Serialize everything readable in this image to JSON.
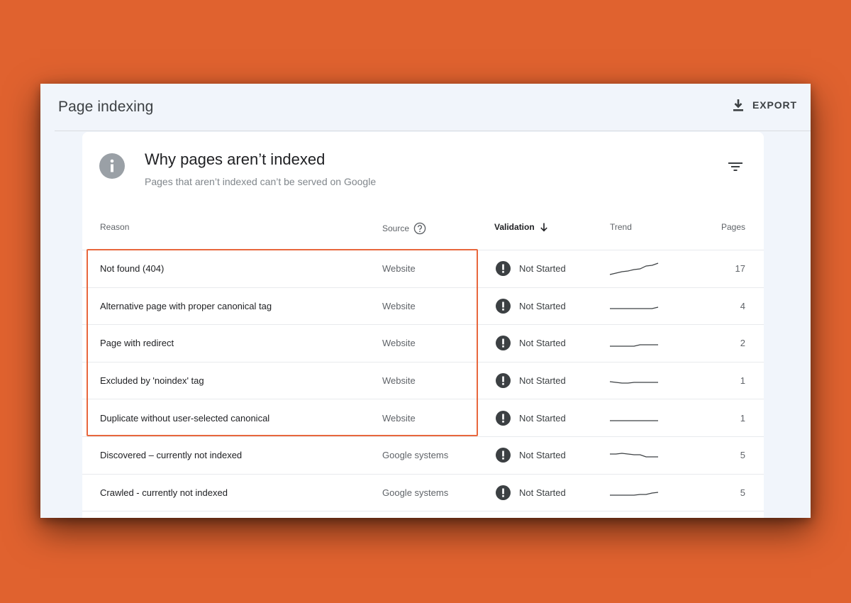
{
  "header": {
    "title": "Page indexing",
    "export_label": "EXPORT"
  },
  "card": {
    "title": "Why pages aren’t indexed",
    "subtitle": "Pages that aren’t indexed can’t be served on Google"
  },
  "columns": {
    "reason": "Reason",
    "source": "Source",
    "validation": "Validation",
    "trend": "Trend",
    "pages": "Pages"
  },
  "rows": [
    {
      "reason": "Not found (404)",
      "source": "Website",
      "validation": "Not Started",
      "pages": "17",
      "trend": [
        0.1,
        0.2,
        0.3,
        0.35,
        0.45,
        0.5,
        0.7,
        0.75,
        0.9
      ]
    },
    {
      "reason": "Alternative page with proper canonical tag",
      "source": "Website",
      "validation": "Not Started",
      "pages": "4",
      "trend": [
        0.3,
        0.3,
        0.3,
        0.3,
        0.3,
        0.3,
        0.3,
        0.3,
        0.4
      ]
    },
    {
      "reason": "Page with redirect",
      "source": "Website",
      "validation": "Not Started",
      "pages": "2",
      "trend": [
        0.3,
        0.3,
        0.3,
        0.3,
        0.3,
        0.4,
        0.4,
        0.4,
        0.4
      ]
    },
    {
      "reason": "Excluded by 'noindex' tag",
      "source": "Website",
      "validation": "Not Started",
      "pages": "1",
      "trend": [
        0.45,
        0.4,
        0.35,
        0.35,
        0.4,
        0.4,
        0.4,
        0.4,
        0.4
      ]
    },
    {
      "reason": "Duplicate without user-selected canonical",
      "source": "Website",
      "validation": "Not Started",
      "pages": "1",
      "trend": [
        0.3,
        0.3,
        0.3,
        0.3,
        0.3,
        0.3,
        0.3,
        0.3,
        0.3
      ]
    },
    {
      "reason": "Discovered – currently not indexed",
      "source": "Google systems",
      "validation": "Not Started",
      "pages": "5",
      "trend": [
        0.6,
        0.6,
        0.65,
        0.6,
        0.55,
        0.55,
        0.4,
        0.4,
        0.4
      ]
    },
    {
      "reason": "Crawled - currently not indexed",
      "source": "Google systems",
      "validation": "Not Started",
      "pages": "5",
      "trend": [
        0.3,
        0.3,
        0.3,
        0.3,
        0.3,
        0.35,
        0.35,
        0.45,
        0.5
      ]
    }
  ],
  "colors": {
    "background": "#e0622f",
    "highlight": "#e8673d",
    "alert_icon": "#3c4043"
  },
  "icons": {
    "export": "download-icon",
    "info": "info-icon",
    "filter": "filter-icon",
    "source_help": "help-circle-icon",
    "sort": "arrow-down-icon",
    "status": "exclamation-circle-icon"
  }
}
